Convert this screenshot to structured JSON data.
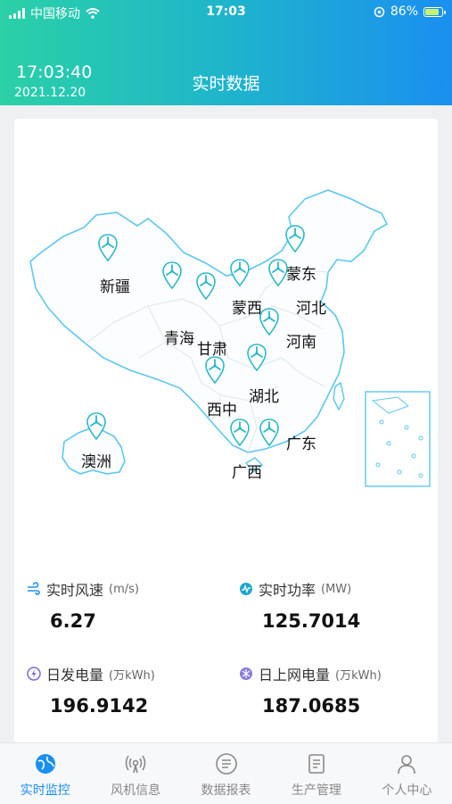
{
  "status_bar": {
    "carrier": "中国移动",
    "time": "17:03",
    "battery": "86%",
    "battery_level": 0.86
  },
  "header": {
    "time": "17:03:40",
    "date": "2021.12.20",
    "title": "实时数据"
  },
  "map": {
    "provinces": [
      {
        "name": "新疆",
        "icon": "wind-turbine-pin-icon"
      },
      {
        "name": "蒙东",
        "icon": "wind-turbine-pin-icon"
      },
      {
        "name": "蒙西",
        "icon": "wind-turbine-pin-icon"
      },
      {
        "name": "河北",
        "icon": "wind-turbine-pin-icon"
      },
      {
        "name": "青海",
        "icon": "wind-turbine-pin-icon"
      },
      {
        "name": "甘肃",
        "icon": "wind-turbine-pin-icon"
      },
      {
        "name": "河南",
        "icon": "wind-turbine-pin-icon"
      },
      {
        "name": "湖北",
        "icon": "wind-turbine-pin-icon"
      },
      {
        "name": "西中",
        "icon": "wind-turbine-pin-icon"
      },
      {
        "name": "广东",
        "icon": "wind-turbine-pin-icon"
      },
      {
        "name": "广西",
        "icon": "wind-turbine-pin-icon"
      },
      {
        "name": "澳洲",
        "icon": "wind-turbine-pin-icon"
      }
    ]
  },
  "metrics": {
    "wind_speed": {
      "label": "实时风速",
      "unit": "(m/s)",
      "value": "6.27",
      "icon": "wind-icon"
    },
    "power": {
      "label": "实时功率",
      "unit": "(MW)",
      "value": "125.7014",
      "icon": "power-wave-icon"
    },
    "daily_generation": {
      "label": "日发电量",
      "unit": "(万kWh)",
      "value": "196.9142",
      "icon": "lightning-icon"
    },
    "daily_grid": {
      "label": "日上网电量",
      "unit": "(万kWh)",
      "value": "187.0685",
      "icon": "grid-icon"
    }
  },
  "tabs": [
    {
      "label": "实时监控",
      "icon": "globe-icon",
      "active": true
    },
    {
      "label": "风机信息",
      "icon": "signal-tower-icon",
      "active": false
    },
    {
      "label": "数据报表",
      "icon": "report-icon",
      "active": false
    },
    {
      "label": "生产管理",
      "icon": "clipboard-icon",
      "active": false
    },
    {
      "label": "个人中心",
      "icon": "user-icon",
      "active": false
    }
  ],
  "colors": {
    "accent": "#1a8ff0",
    "header_start": "#2bd0a6",
    "header_end": "#1a8ff0",
    "map_outline": "#5cc7f0",
    "pin": "#2ab7c7"
  }
}
